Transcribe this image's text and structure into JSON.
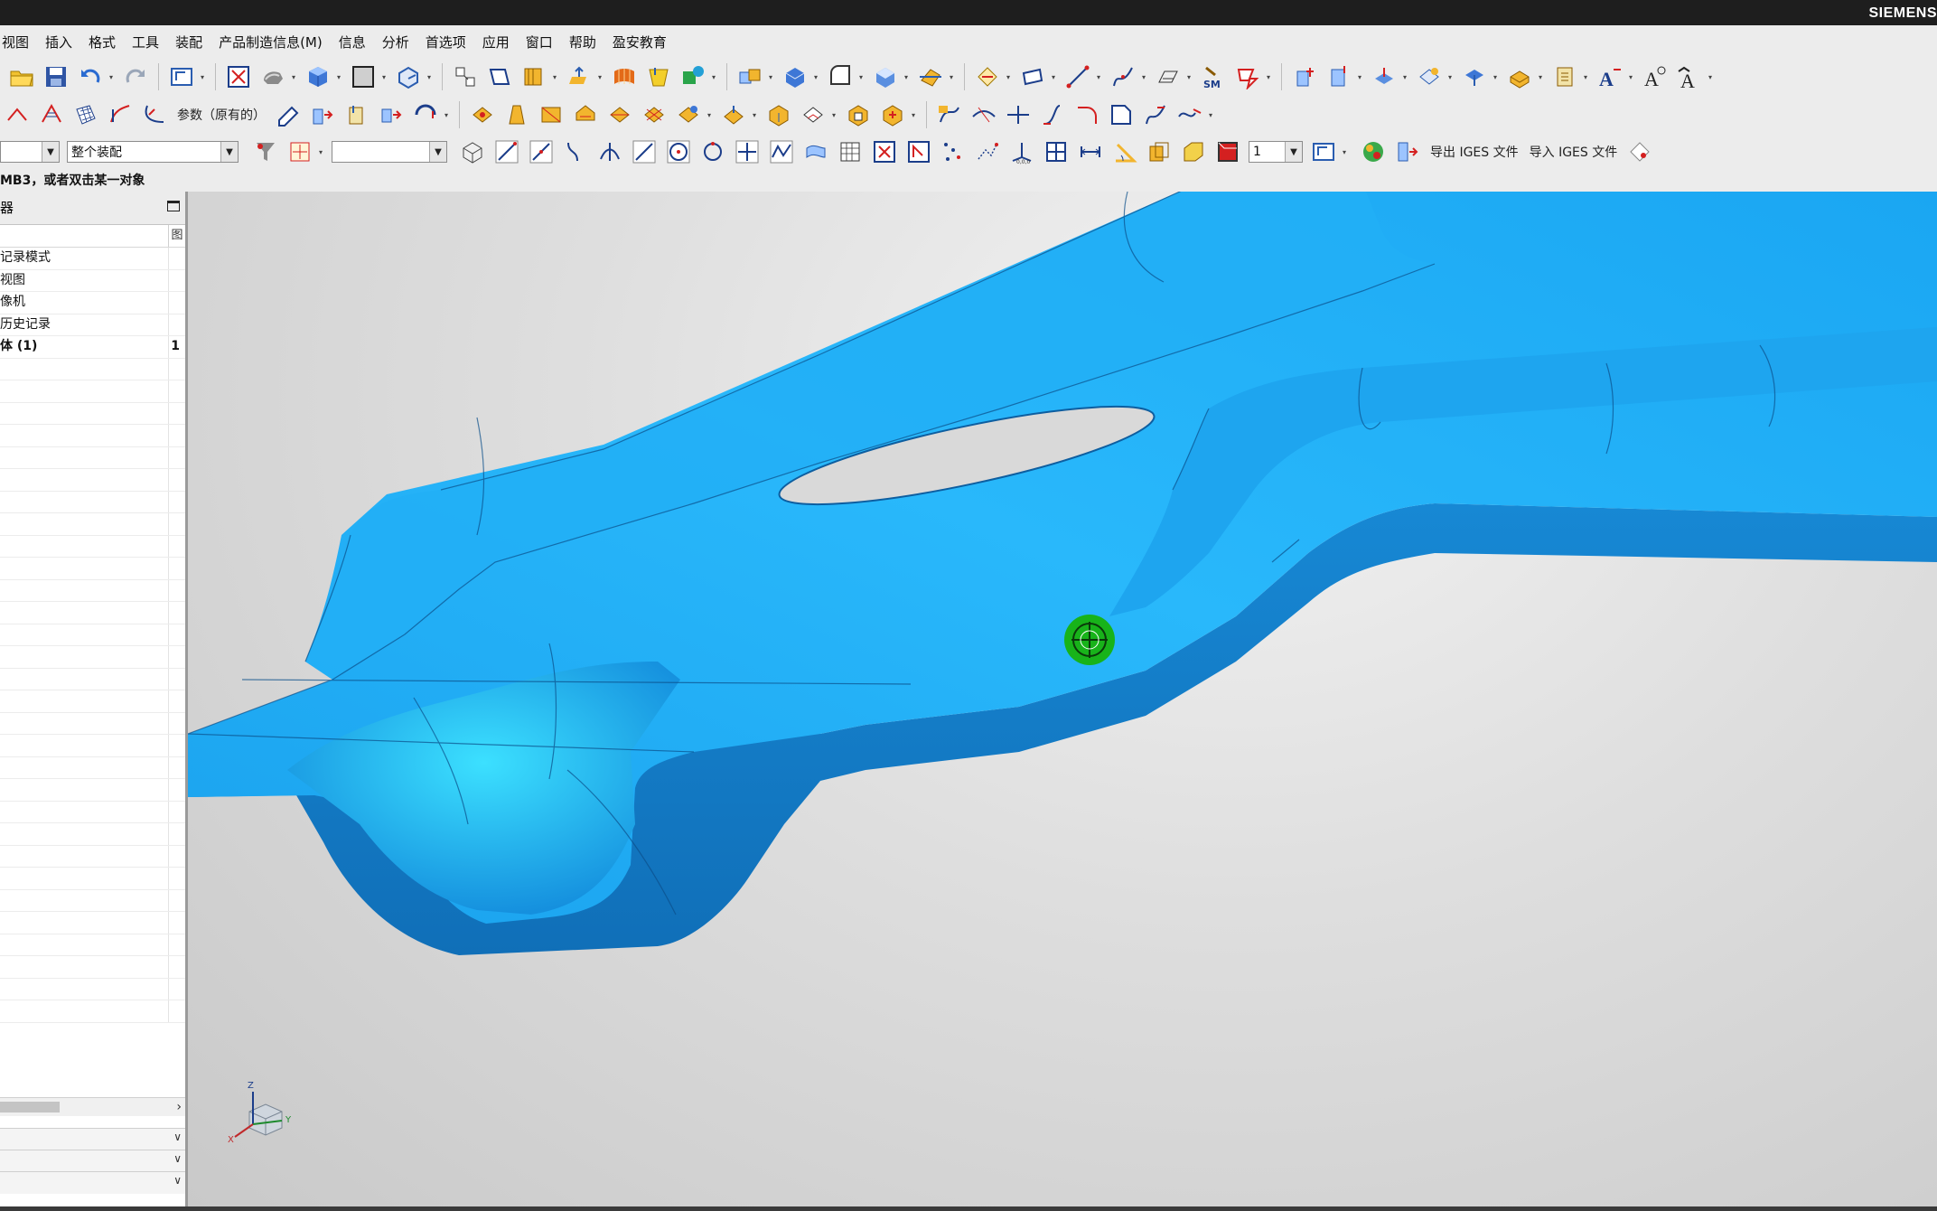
{
  "title_bar": {
    "brand": "SIEMENS"
  },
  "menu": {
    "items": [
      "视图",
      "插入",
      "格式",
      "工具",
      "装配",
      "产品制造信息(M)",
      "信息",
      "分析",
      "首选项",
      "应用",
      "窗口",
      "帮助",
      "盈安教育"
    ]
  },
  "toolbar2": {
    "params_label": "参数（原有的）"
  },
  "toolbar3": {
    "assembly_scope": "整个装配",
    "filter_value": "",
    "layer_value": "1",
    "export_iges": "导出 IGES 文件",
    "import_iges": "导入 IGES 文件"
  },
  "status": {
    "prompt": "MB3，或者双击某一对象"
  },
  "navigator": {
    "title": "器",
    "col2_header": "图",
    "rows": [
      {
        "label": "记录模式",
        "value": ""
      },
      {
        "label": "视图",
        "value": ""
      },
      {
        "label": "像机",
        "value": ""
      },
      {
        "label": "历史记录",
        "value": ""
      },
      {
        "label": "体 (1)",
        "value": "1"
      }
    ]
  },
  "viewport": {
    "part_color": "#1ea9f2",
    "cursor_color": "#18b31a",
    "triad_labels": {
      "z": "Z",
      "y": "Y",
      "x": "X"
    }
  }
}
